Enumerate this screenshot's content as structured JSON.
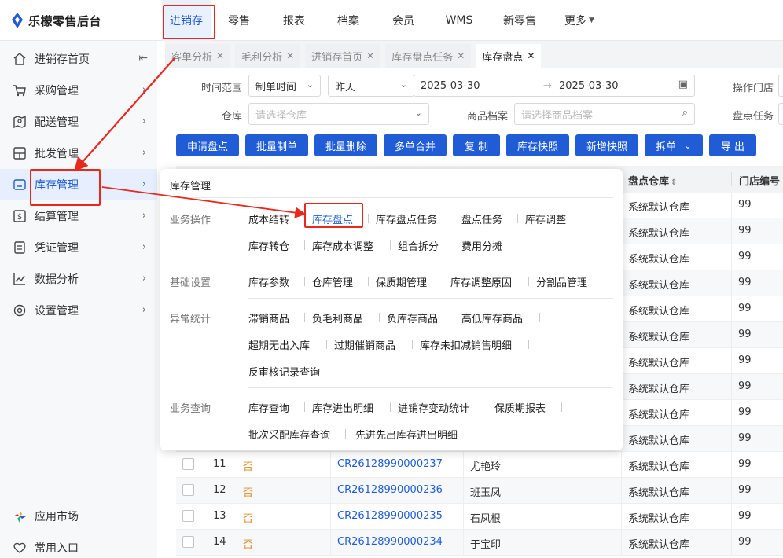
{
  "app": {
    "title": "乐檬零售后台",
    "accent": "#1f5cd6"
  },
  "topnav": [
    "进销存",
    "零售",
    "报表",
    "档案",
    "会员",
    "WMS",
    "新零售",
    "更多"
  ],
  "sidebar": {
    "items": [
      "进销存首页",
      "采购管理",
      "配送管理",
      "批发管理",
      "库存管理",
      "结算管理",
      "凭证管理",
      "数据分析",
      "设置管理"
    ],
    "bottom": [
      "应用市场",
      "常用入口"
    ]
  },
  "tabs": [
    "客单分析",
    "毛利分析",
    "进销存首页",
    "库存盘点任务",
    "库存盘点"
  ],
  "filters": {
    "time_label": "时间范围",
    "time_type": "制单时间",
    "date_preset": "昨天",
    "date_start": "2025-03-30",
    "date_end": "2025-03-30",
    "store_label": "操作门店",
    "warehouse_label": "仓库",
    "warehouse_placeholder": "请选择仓库",
    "product_label": "商品档案",
    "product_placeholder": "请选择商品档案",
    "task_label": "盘点任务"
  },
  "buttons": [
    "申请盘点",
    "批量制单",
    "批量删除",
    "多单合并",
    "复 制",
    "库存快照",
    "新增快照",
    "拆单",
    "导 出"
  ],
  "table": {
    "headers": {
      "warehouse": "盘点仓库",
      "store_no": "门店编号"
    },
    "bg_rows": [
      {
        "warehouse": "系统默认仓库",
        "store_no": "99"
      },
      {
        "warehouse": "系统默认仓库",
        "store_no": "99"
      },
      {
        "warehouse": "系统默认仓库",
        "store_no": "99"
      },
      {
        "warehouse": "系统默认仓库",
        "store_no": "99"
      },
      {
        "warehouse": "系统默认仓库",
        "store_no": "99"
      },
      {
        "warehouse": "系统默认仓库",
        "store_no": "99"
      },
      {
        "warehouse": "系统默认仓库",
        "store_no": "99"
      },
      {
        "warehouse": "系统默认仓库",
        "store_no": "99"
      },
      {
        "warehouse": "系统默认仓库",
        "store_no": "99"
      },
      {
        "warehouse": "系统默认仓库",
        "store_no": "99"
      }
    ],
    "rows": [
      {
        "idx": "11",
        "flag": "否",
        "code": "CR26128990000237",
        "person": "尤艳玲",
        "warehouse": "系统默认仓库",
        "store_no": "99"
      },
      {
        "idx": "12",
        "flag": "否",
        "code": "CR26128990000236",
        "person": "班玉凤",
        "warehouse": "系统默认仓库",
        "store_no": "99"
      },
      {
        "idx": "13",
        "flag": "否",
        "code": "CR26128990000235",
        "person": "石凤根",
        "warehouse": "系统默认仓库",
        "store_no": "99"
      },
      {
        "idx": "14",
        "flag": "否",
        "code": "CR26128990000234",
        "person": "于宝印",
        "warehouse": "系统默认仓库",
        "store_no": "99"
      }
    ]
  },
  "popup": {
    "title": "库存管理",
    "categories": [
      {
        "name": "业务操作",
        "lines": [
          [
            "成本结转",
            "库存盘点",
            "库存盘点任务",
            "盘点任务",
            "库存调整"
          ],
          [
            "库存转仓",
            "库存成本调整",
            "组合拆分",
            "费用分摊"
          ]
        ]
      },
      {
        "name": "基础设置",
        "lines": [
          [
            "库存参数",
            "仓库管理",
            "保质期管理",
            "库存调整原因",
            "分割品管理"
          ]
        ]
      },
      {
        "name": "异常统计",
        "lines": [
          [
            "滞销商品",
            "负毛利商品",
            "负库存商品",
            "高低库存商品"
          ],
          [
            "超期无出入库",
            "过期催销商品",
            "库存未扣减销售明细"
          ],
          [
            "反审核记录查询"
          ]
        ]
      },
      {
        "name": "业务查询",
        "lines": [
          [
            "库存查询",
            "库存进出明细",
            "进销存变动统计",
            "保质期报表"
          ],
          [
            "批次采配库存查询",
            "先进先出库存进出明细"
          ]
        ]
      }
    ]
  }
}
